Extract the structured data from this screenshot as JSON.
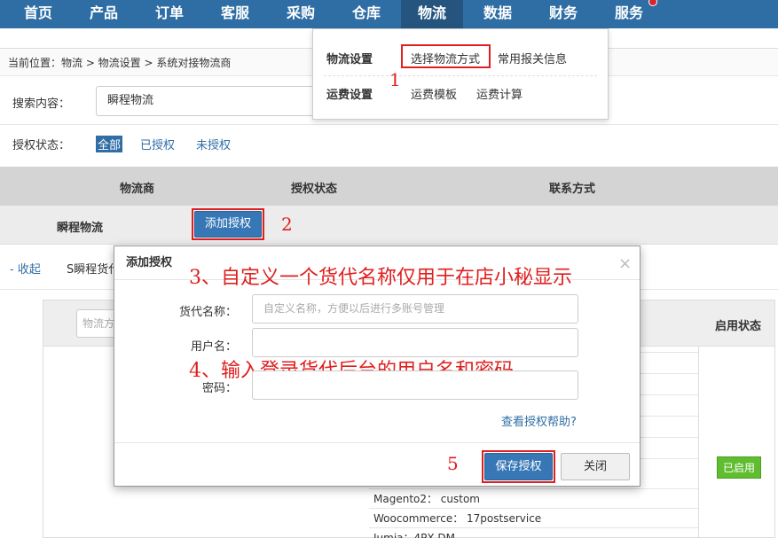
{
  "nav": {
    "items": [
      "首页",
      "产品",
      "订单",
      "客服",
      "采购",
      "仓库",
      "物流",
      "数据",
      "财务",
      "服务"
    ],
    "active": "物流"
  },
  "breadcrumb": "当前位置：物流 > 物流设置 >  系统对接物流商",
  "search": {
    "label": "搜索内容：",
    "value": "瞬程物流"
  },
  "auth_filter": {
    "label": "授权状态：",
    "options": [
      "全部",
      "已授权",
      "未授权"
    ],
    "selected": "全部"
  },
  "table": {
    "headers": [
      "物流商",
      "授权状态",
      "联系方式"
    ],
    "row_name": "瞬程物流",
    "add_auth_label": "添加授权"
  },
  "expand_row": {
    "collapse_label": "- 收起",
    "sub_label": "S瞬程货代"
  },
  "inner_panel": {
    "search_placeholder": "物流方",
    "enable_header": "启用状态",
    "enabled_badge": "已启用",
    "platforms": [
      "Magento2： custom",
      "Woocommerce： 17postservice",
      "Jumia：4PX-DM"
    ]
  },
  "dropdown": {
    "group1": "物流设置",
    "group1_links": [
      "选择物流方式",
      "常用报关信息"
    ],
    "group2": "运费设置",
    "group2_links": [
      "运费模板",
      "运费计算"
    ]
  },
  "modal": {
    "title": "添加授权",
    "close_symbol": "×",
    "fields": [
      {
        "label": "货代名称：",
        "placeholder": "自定义名称，方便以后进行多账号管理"
      },
      {
        "label": "用户名：",
        "placeholder": ""
      },
      {
        "label": "密码：",
        "placeholder": ""
      }
    ],
    "help_link": "查看授权帮助?",
    "save_label": "保存授权",
    "close_label": "关闭"
  },
  "annotations": {
    "n1": "1",
    "n2": "2",
    "n3": "3、自定义一个货代名称仅用于在店小秘显示",
    "n4": "4、输入登录货代后台的用户名和密码",
    "n5": "5"
  },
  "colors": {
    "nav_bg": "#2f6ea5",
    "nav_active": "#25557f",
    "annotation_red": "#e01f1f",
    "enabled_green": "#5fbd2f"
  }
}
